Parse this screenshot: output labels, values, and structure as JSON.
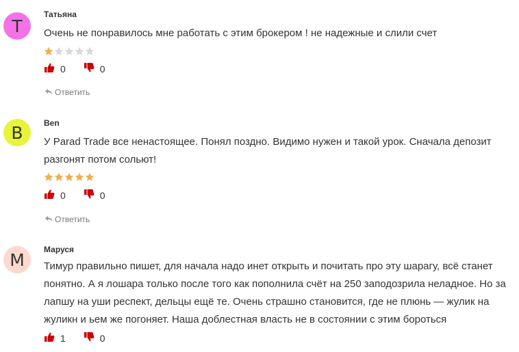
{
  "colors": {
    "star_filled": "#f0b04a",
    "star_empty": "#d9d9d9",
    "thumb": "#cc0000"
  },
  "icons": {
    "like": "thumbs-up-icon",
    "dislike": "thumbs-down-icon",
    "reply": "reply-arrow-icon",
    "star": "star-icon"
  },
  "comments": [
    {
      "avatar_letter": "T",
      "avatar_color": "#f572e6",
      "author": "Татьяна",
      "text_lines": [
        "Очень не понравилось мне работать с этим брокером ! не надежные и слили счет"
      ],
      "rating": 1,
      "rating_max": 5,
      "likes": "0",
      "dislikes": "0",
      "reply_label": "Ответить"
    },
    {
      "avatar_letter": "B",
      "avatar_color": "#e6f53a",
      "author": "Ben",
      "text_lines": [
        "У Parad Trade все ненастоящее. Понял поздно. Видимо нужен и такой урок. Сначала депозит",
        "разгонят потом сольют!"
      ],
      "rating": 5,
      "rating_max": 5,
      "likes": "0",
      "dislikes": "0",
      "reply_label": "Ответить"
    },
    {
      "avatar_letter": "M",
      "avatar_color": "#fbd9cf",
      "author": "Маруся",
      "text_lines": [
        "Тимур правильно пишет, для начала надо инет открыть и почитать про эту шарагу, всё станет",
        "понятно. А я лошара только после того как пополнила счёт на 250 заподозрила неладное. Но за",
        "лапшу на уши респект, дельцы ещё те. Очень страшно становится, где не плюнь — жулик на",
        "жуликн и ьем же погоняет. Наша доблестная власть не в состоянии с этим бороться"
      ],
      "likes": "1",
      "dislikes": "0"
    }
  ]
}
